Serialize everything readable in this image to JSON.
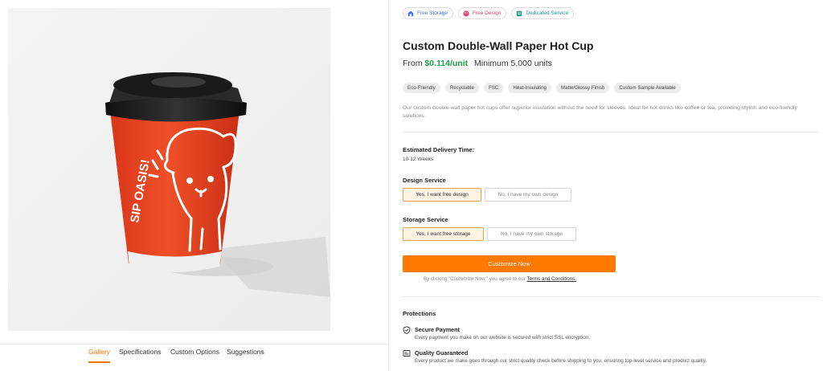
{
  "gallery": {
    "tabs": [
      {
        "label": "Gallery",
        "active": true
      },
      {
        "label": "Specifications",
        "active": false
      },
      {
        "label": "Custom Options",
        "active": false
      },
      {
        "label": "Suggestions",
        "active": false
      }
    ]
  },
  "product_image": {
    "cup_text": "SIP OASIS!",
    "cup_color": "#ef4a24",
    "lid_color": "#1e1e1e"
  },
  "badges": [
    {
      "label": "Free Storage",
      "icon": "storage-icon",
      "color": "#3a6ff0"
    },
    {
      "label": "Free Design",
      "icon": "palette-icon",
      "color": "#e0457a"
    },
    {
      "label": "Dedicated Service",
      "icon": "service-icon",
      "color": "#1a9a84"
    }
  ],
  "product": {
    "title": "Custom Double-Wall Paper Hot Cup",
    "price_prefix": "From",
    "price": "$0.114/unit",
    "minimum": "Minimum 5,000 units",
    "price_color": "#1aa14a",
    "tags": [
      "Eco-Friendly",
      "Recyclable",
      "FSC",
      "Heat-Insulating",
      "Matte/Glossy Finish",
      "Custom Sample Available"
    ],
    "description": "Our custom double-wall paper hot cups offer superior insulation without the need for sleeves. Ideal for hot drinks like coffee or tea, providing stylish and eco-friendly solutions."
  },
  "delivery": {
    "label": "Estimated Delivery Time:",
    "value": "10-12 Weeks"
  },
  "design_service": {
    "label": "Design Service",
    "options": [
      {
        "label": "Yes, I want free design",
        "selected": true
      },
      {
        "label": "No, I have my own design",
        "selected": false
      }
    ]
  },
  "storage_service": {
    "label": "Storage Service",
    "options": [
      {
        "label": "Yes, I want free storage",
        "selected": true
      },
      {
        "label": "No, I have my own storage",
        "selected": false
      }
    ]
  },
  "cta": {
    "label": "Customize Now",
    "color": "#ff7a00",
    "agree_prefix": "By clicking \"Customize Now,\" you agree to our",
    "agree_link": "Terms and Conditions."
  },
  "protections": {
    "heading": "Protections",
    "items": [
      {
        "icon": "shield-check-icon",
        "title": "Secure Payment",
        "text": "Every payment you make on our website is secured with strict SSL encryption."
      },
      {
        "icon": "quality-badge-icon",
        "title": "Quality Guaranteed",
        "text": "Every product we make goes through our strict quality check before shipping to you, ensuring top-level service and product quality."
      }
    ]
  }
}
